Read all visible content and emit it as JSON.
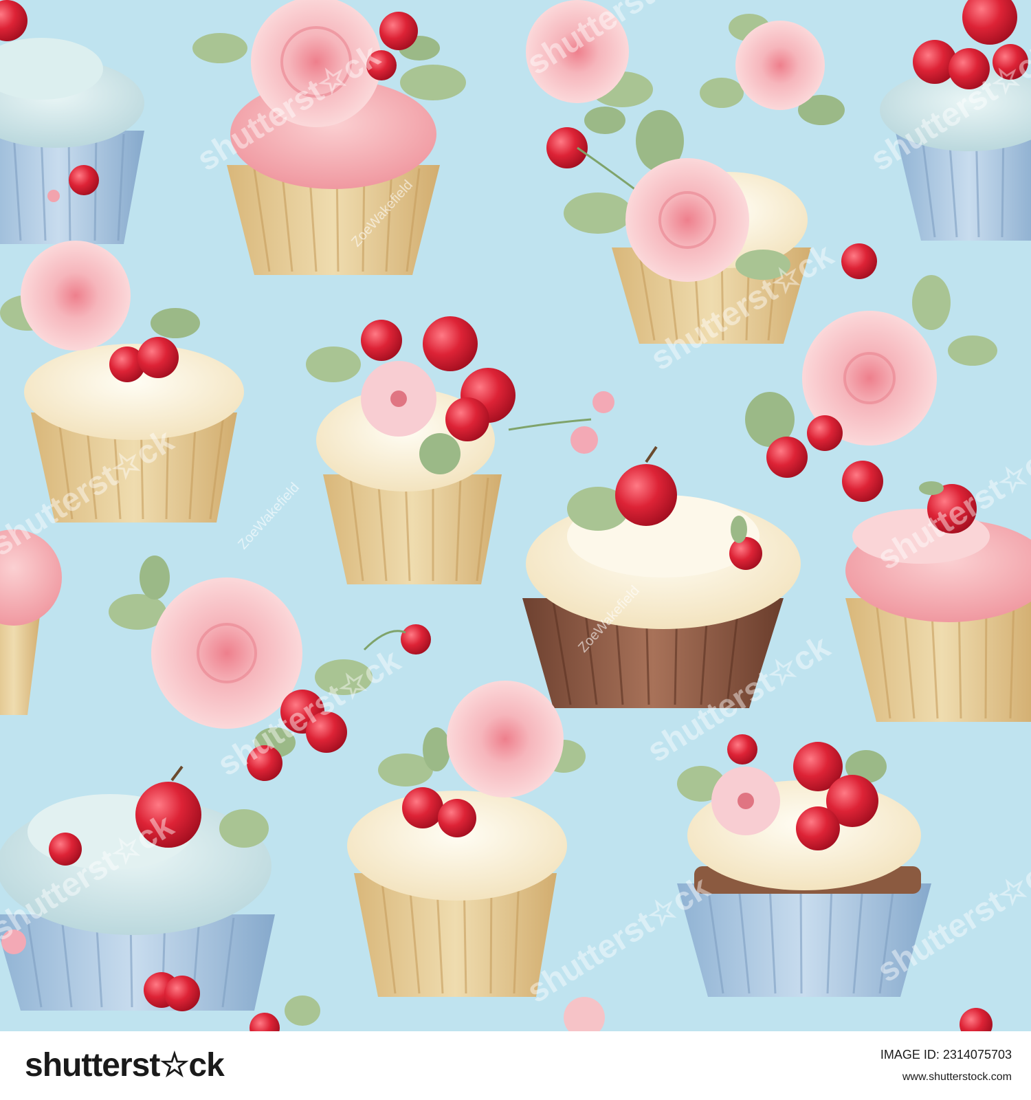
{
  "image": {
    "background_color": "#bfe3ef",
    "palette": {
      "blue_frosting": "#cfe6ea",
      "blue_wrapper": "#a9c9e3",
      "pink_frosting": "#f5a9b0",
      "cream_frosting": "#fbf3df",
      "tan_wrapper": "#e7cf9f",
      "brown_wrapper": "#8d5b46",
      "rose": "#f6c3c7",
      "berry_red": "#d61f32",
      "leaf_green": "#a9c493"
    },
    "watermark_text": "shutterst☆ck",
    "author_text": "ZoeWakefield"
  },
  "footer": {
    "brand": "shutterst☆ck",
    "image_id": "IMAGE ID: 2314075703",
    "site": "www.shutterstock.com"
  }
}
